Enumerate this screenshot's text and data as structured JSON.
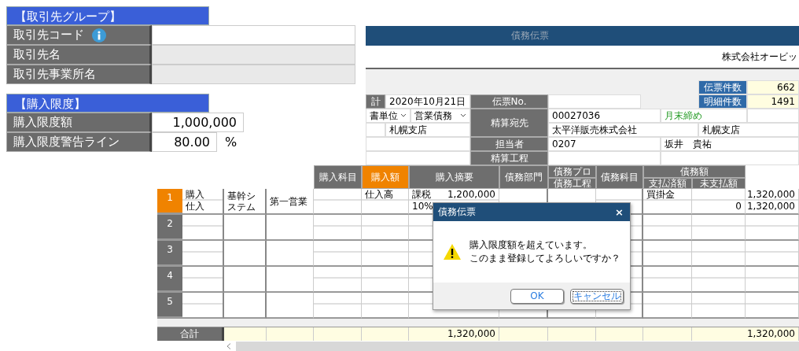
{
  "partner_form": {
    "sections": [
      {
        "title": "【取引先グループ】",
        "fields": [
          {
            "label": "取引先コード",
            "kind": "text",
            "info_icon": true
          },
          {
            "label": "取引先名",
            "kind": "readonly",
            "info_icon": false
          },
          {
            "label": "取引先事業所名",
            "kind": "readonly",
            "info_icon": false
          }
        ]
      },
      {
        "title": "【購入限度】",
        "fields": [
          {
            "label": "購入限度額",
            "kind": "amount",
            "value": "1,000,000",
            "info_icon": false
          },
          {
            "label": "購入限度警告ライン",
            "kind": "percent",
            "value": "80.00",
            "unit": "%",
            "info_icon": false
          }
        ]
      }
    ]
  },
  "voucher_window": {
    "title": "債務伝票",
    "company": "株式会社オービッ",
    "counts": [
      {
        "label": "伝票件数",
        "value": "662"
      },
      {
        "label": "明細件数",
        "value": "1491"
      }
    ],
    "header": {
      "date_label": "計",
      "date": "2020年10月21日",
      "voucher_no_label": "伝票No.",
      "unit_select": "書単位",
      "type_select": "営業債務",
      "branch": "札幌支店",
      "settlement_label": "精算宛先",
      "settlement_code": "00027036",
      "closing": "月末締め",
      "settlement_name": "太平洋販売株式会社",
      "settlement_branch": "札幌支店",
      "staff_label": "担当者",
      "staff_code": "0207",
      "staff_name": "坂井　貴祐",
      "process_label": "精算工程"
    }
  },
  "detail_table": {
    "columns": [
      {
        "label": "購入科目",
        "selected": false
      },
      {
        "label": "購入額",
        "selected": true
      },
      {
        "label": "購入摘要",
        "selected": false
      },
      {
        "label": "債務部門",
        "selected": false
      },
      {
        "label": "債務プロ",
        "sub": [
          "債務工程"
        ],
        "selected": false
      },
      {
        "label": "債務科目",
        "selected": false
      },
      {
        "label": "債務額",
        "sub": [
          "支払済額",
          "未支払額"
        ],
        "selected": false
      }
    ],
    "rows": [
      {
        "number": "1",
        "selected": true,
        "item": [
          "購入",
          "仕入"
        ],
        "project": "基幹システム",
        "department": "第一営業",
        "account": "仕入高",
        "tax": "課税",
        "amount": "1,200,000",
        "tax_rate": "10%",
        "payable_account": "買掛金",
        "paid": "0",
        "unpaid_total": "1,320,000",
        "unpaid": "1,320,000"
      },
      {
        "number": "2",
        "selected": false
      },
      {
        "number": "3",
        "selected": false
      },
      {
        "number": "4",
        "selected": false
      },
      {
        "number": "5",
        "selected": false
      }
    ],
    "total": {
      "label": "合計",
      "amount": "1,320,000",
      "unpaid": "1,320,000"
    }
  },
  "dialog": {
    "title": "債務伝票",
    "close": "×",
    "message": [
      "購入限度額を超えています。",
      "このまま登録してよろしいですか？"
    ],
    "buttons": [
      {
        "label": "OK",
        "focused": false
      },
      {
        "label": "キャンセル",
        "focused": true
      }
    ]
  }
}
